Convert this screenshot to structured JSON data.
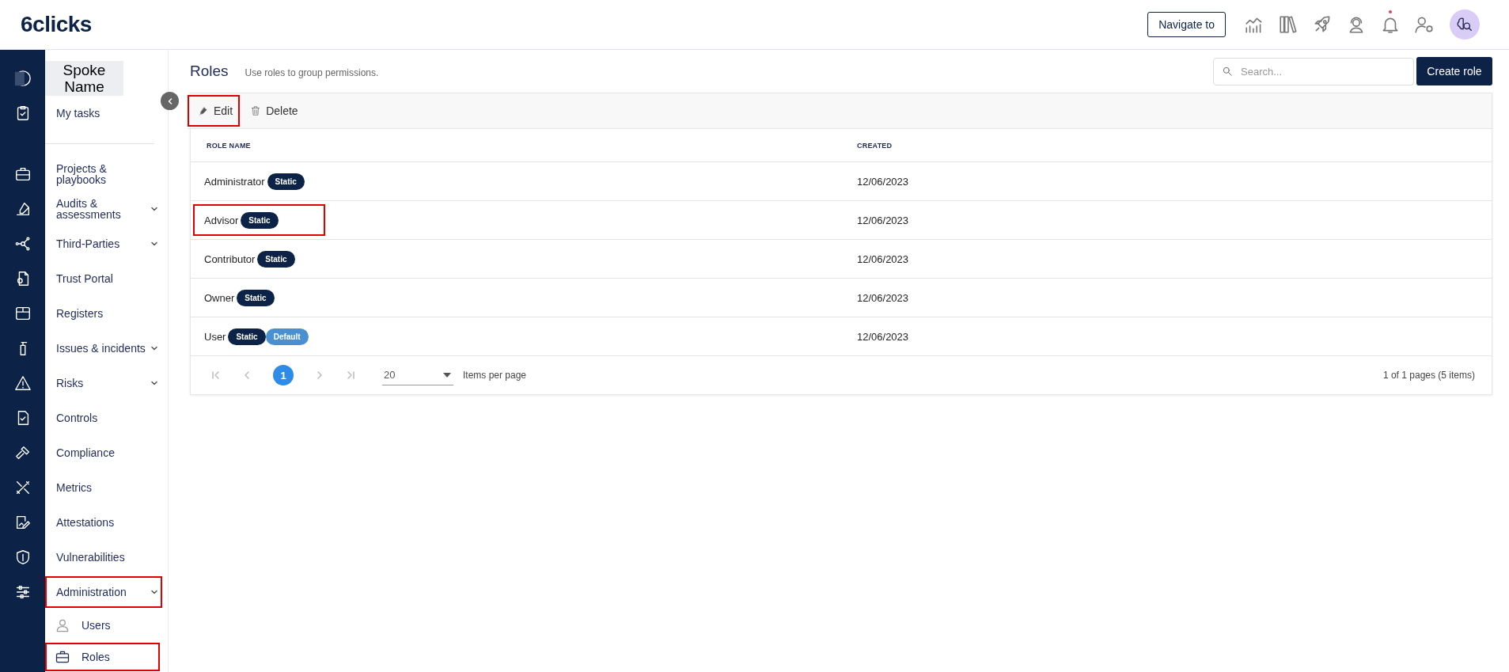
{
  "header": {
    "logo": "6clicks",
    "navigate_button": "Navigate to",
    "notifications_unread": true
  },
  "sidebar": {
    "workspace": "Spoke Name",
    "top_items": [
      {
        "label": "My tasks",
        "expandable": false,
        "highlighted": false
      }
    ],
    "items": [
      {
        "label": "Projects & playbooks",
        "expandable": false,
        "highlighted": false
      },
      {
        "label": "Audits & assessments",
        "expandable": true,
        "highlighted": false
      },
      {
        "label": "Third-Parties",
        "expandable": true,
        "highlighted": false
      },
      {
        "label": "Trust Portal",
        "expandable": false,
        "highlighted": false
      },
      {
        "label": "Registers",
        "expandable": false,
        "highlighted": false
      },
      {
        "label": "Issues & incidents",
        "expandable": true,
        "highlighted": false
      },
      {
        "label": "Risks",
        "expandable": true,
        "highlighted": false
      },
      {
        "label": "Controls",
        "expandable": false,
        "highlighted": false
      },
      {
        "label": "Compliance",
        "expandable": false,
        "highlighted": false
      },
      {
        "label": "Metrics",
        "expandable": false,
        "highlighted": false
      },
      {
        "label": "Attestations",
        "expandable": false,
        "highlighted": false
      },
      {
        "label": "Vulnerabilities",
        "expandable": false,
        "highlighted": false
      },
      {
        "label": "Administration",
        "expandable": true,
        "highlighted": true,
        "children": [
          {
            "label": "Users",
            "highlighted": false
          },
          {
            "label": "Roles",
            "highlighted": true
          }
        ]
      }
    ]
  },
  "page": {
    "title": "Roles",
    "subtitle": "Use roles to group permissions.",
    "search_placeholder": "Search...",
    "create_button": "Create role"
  },
  "toolbar": [
    {
      "label": "Edit",
      "kind": "edit",
      "highlighted": true
    },
    {
      "label": "Delete",
      "kind": "delete",
      "highlighted": false
    }
  ],
  "table": {
    "columns": [
      "ROLE NAME",
      "CREATED"
    ],
    "rows": [
      {
        "name": "Administrator",
        "badges": [
          {
            "label": "Static",
            "kind": "static"
          }
        ],
        "created": "12/06/2023",
        "highlighted": false
      },
      {
        "name": "Advisor",
        "badges": [
          {
            "label": "Static",
            "kind": "static"
          }
        ],
        "created": "12/06/2023",
        "highlighted": true
      },
      {
        "name": "Contributor",
        "badges": [
          {
            "label": "Static",
            "kind": "static"
          }
        ],
        "created": "12/06/2023",
        "highlighted": false
      },
      {
        "name": "Owner",
        "badges": [
          {
            "label": "Static",
            "kind": "static"
          }
        ],
        "created": "12/06/2023",
        "highlighted": false
      },
      {
        "name": "User",
        "badges": [
          {
            "label": "Static",
            "kind": "static"
          },
          {
            "label": "Default",
            "kind": "default"
          }
        ],
        "created": "12/06/2023",
        "highlighted": false
      }
    ]
  },
  "pagination": {
    "current_page": "1",
    "page_size": "20",
    "page_size_label": "Items per page",
    "summary": "1 of 1 pages (5 items)"
  }
}
